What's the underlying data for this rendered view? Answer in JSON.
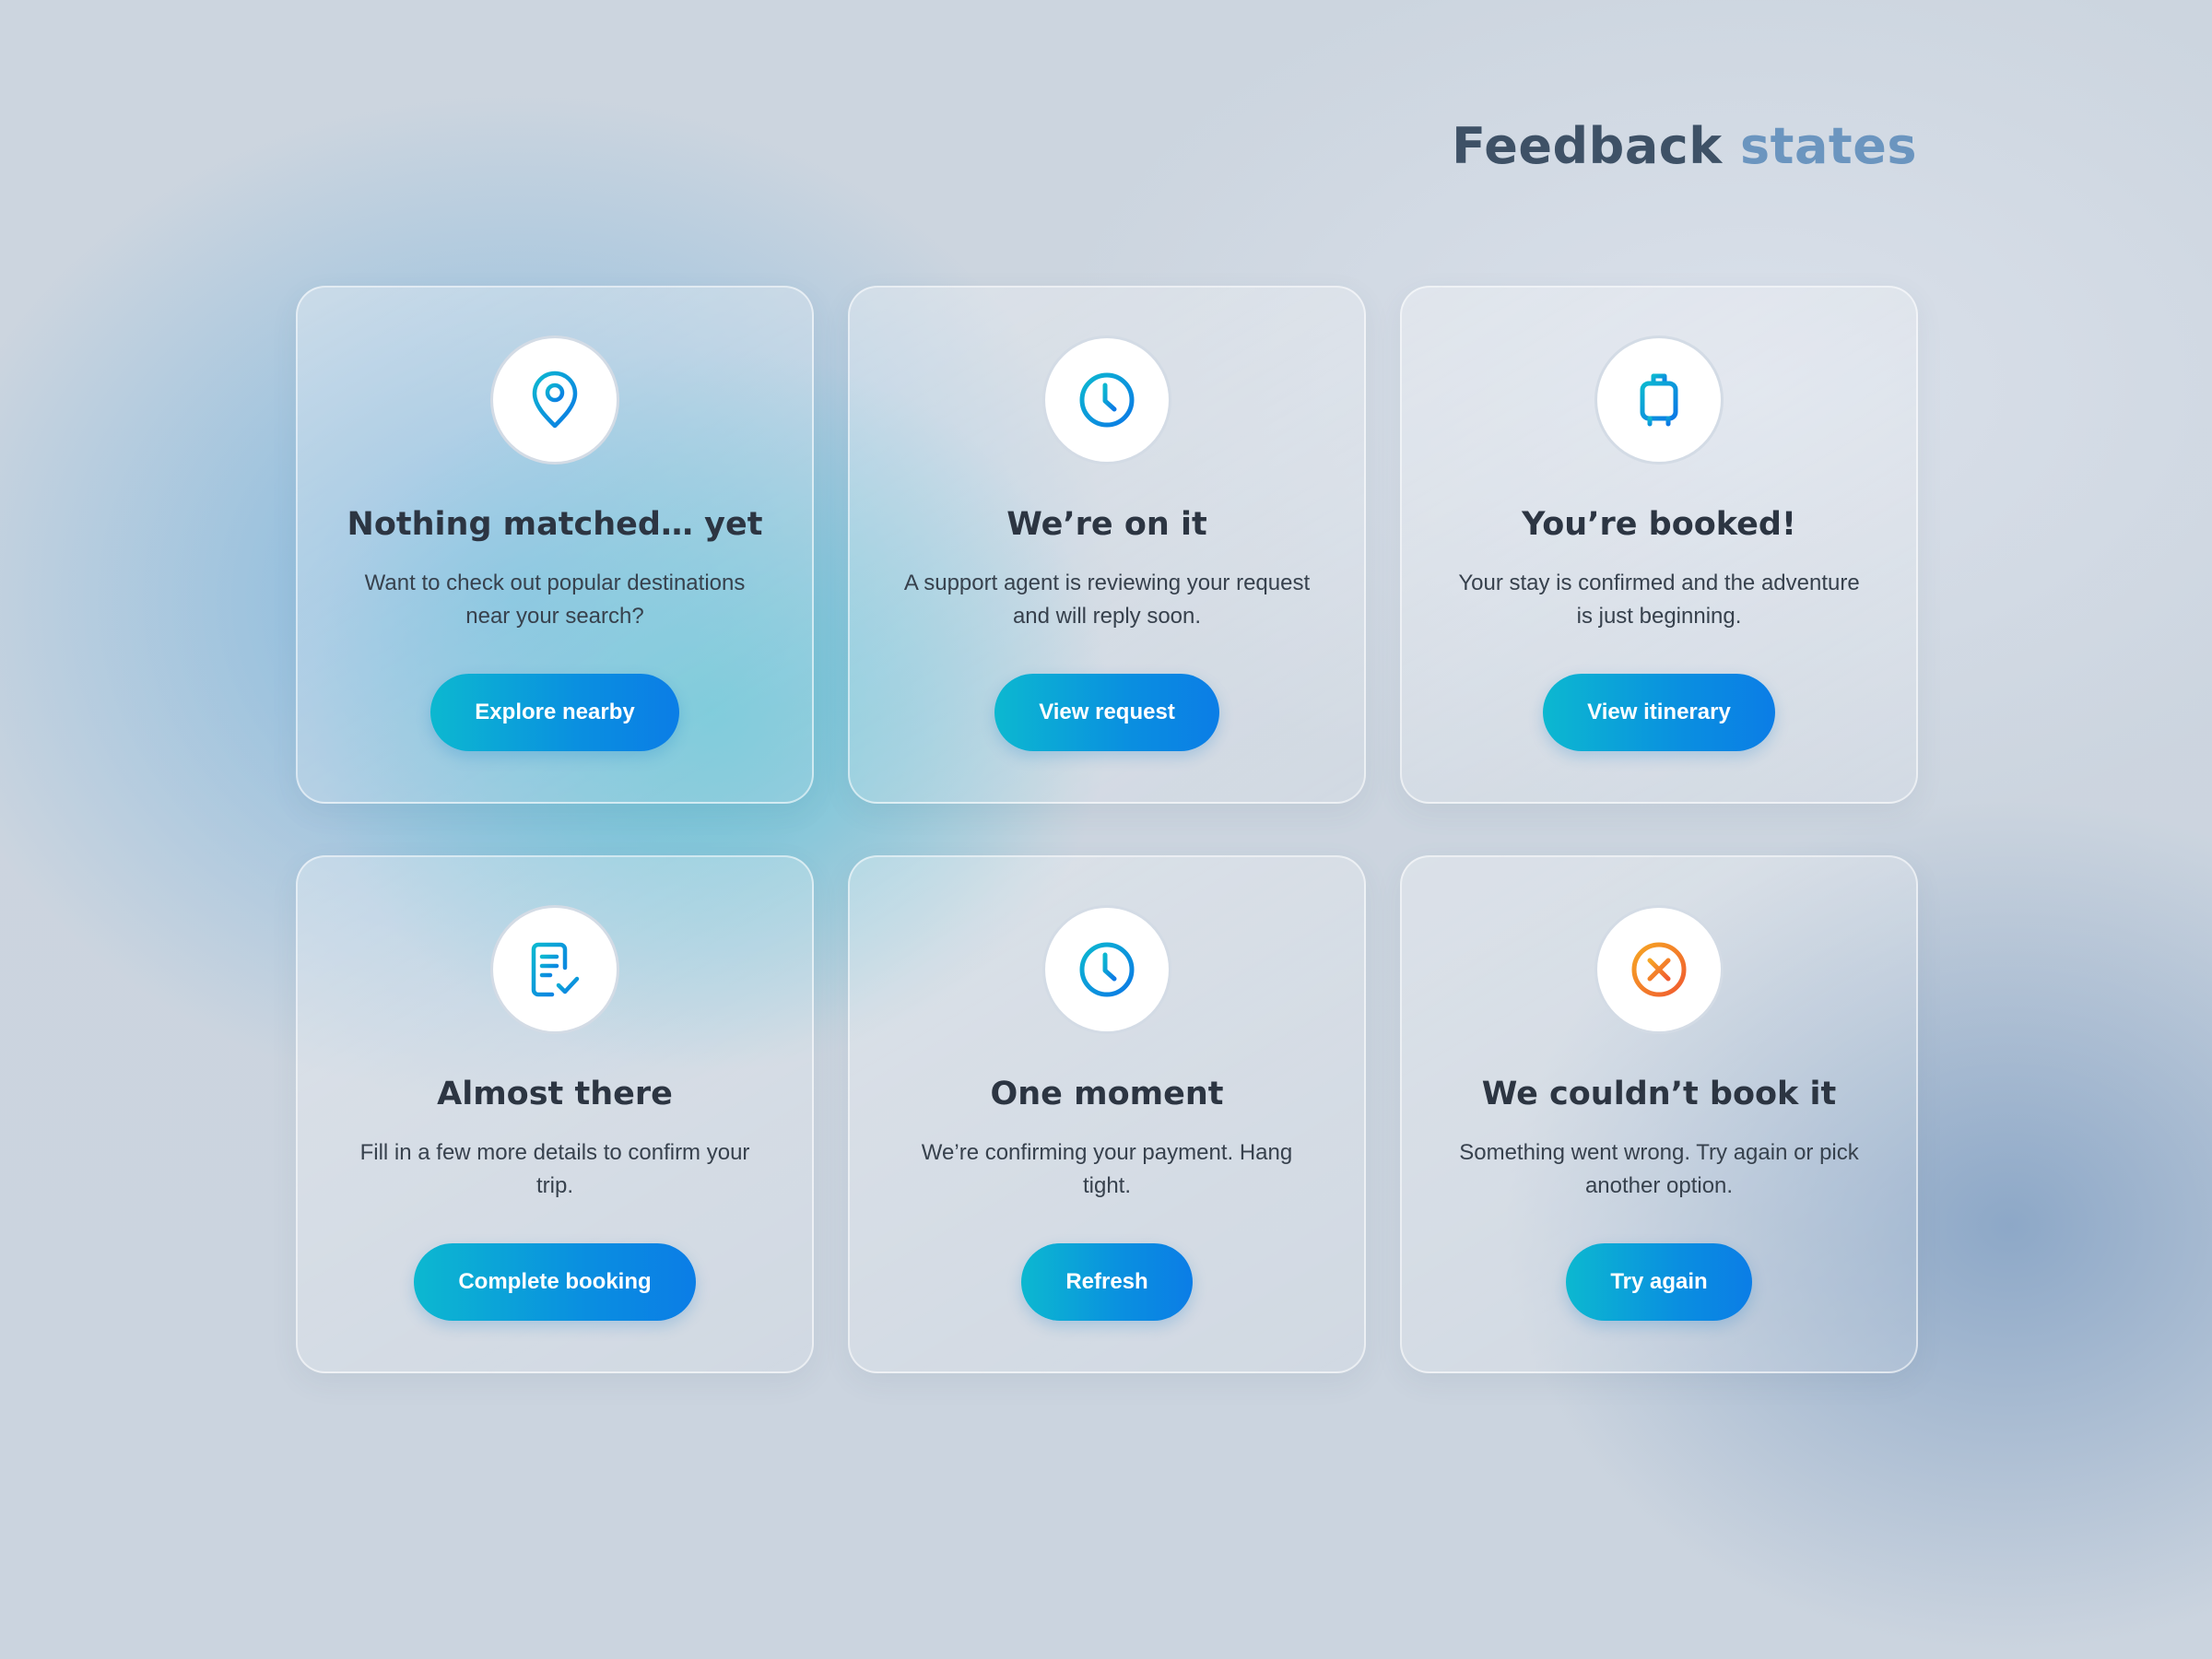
{
  "page": {
    "heading_part1": "Feedback",
    "heading_part2": "states"
  },
  "colors": {
    "accent_blue": "#0b8ee0",
    "accent_cyan": "#0cb8d0",
    "error_orange": "#f2762e"
  },
  "cards": [
    {
      "icon": "map-pin-icon",
      "title": "Nothing matched… yet",
      "description": "Want to check out popular destinations near your search?",
      "button": "Explore nearby"
    },
    {
      "icon": "clock-icon",
      "title": "We’re on it",
      "description": "A support agent is reviewing your request and will reply soon.",
      "button": "View request"
    },
    {
      "icon": "suitcase-icon",
      "title": "You’re booked!",
      "description": "Your stay is confirmed and the adventure is just beginning.",
      "button": "View itinerary"
    },
    {
      "icon": "document-check-icon",
      "title": "Almost there",
      "description": "Fill in a few more details to confirm your trip.",
      "button": "Complete booking"
    },
    {
      "icon": "clock-icon",
      "title": "One moment",
      "description": "We’re confirming your payment. Hang tight.",
      "button": "Refresh"
    },
    {
      "icon": "error-x-circle-icon",
      "title": "We couldn’t book it",
      "description": "Something went wrong. Try again or pick another option.",
      "button": "Try again"
    }
  ]
}
